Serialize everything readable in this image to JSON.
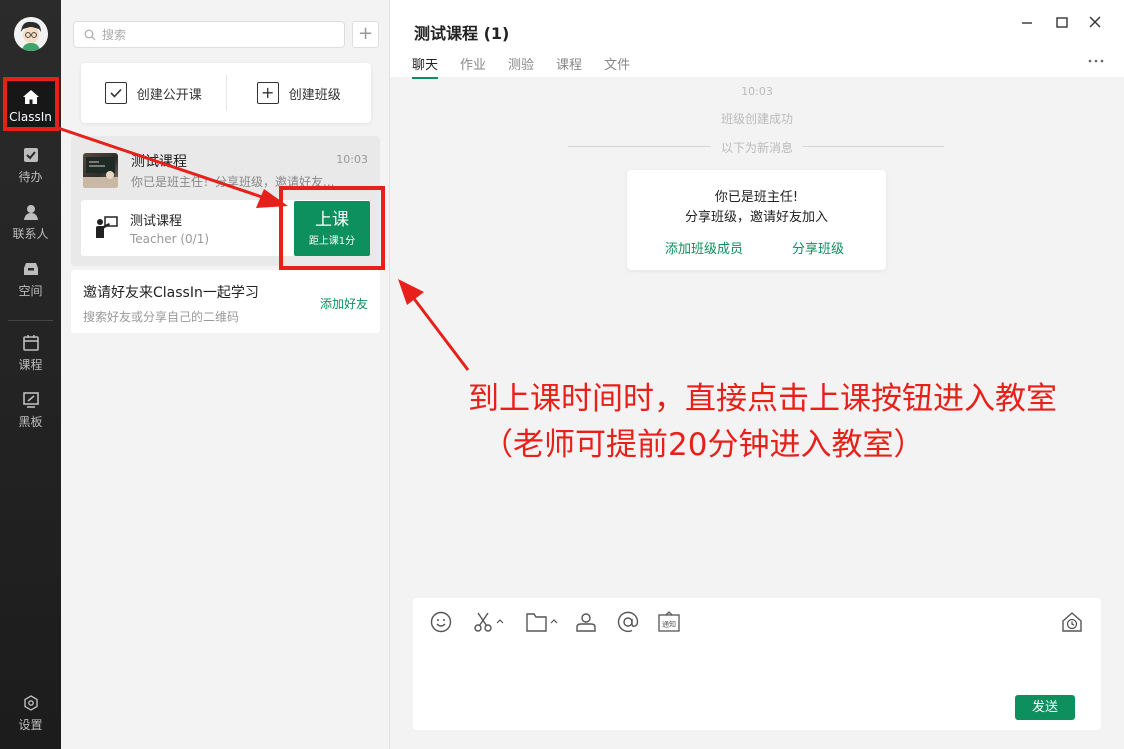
{
  "sidebar": {
    "items": [
      {
        "label": "ClassIn",
        "icon": "home-icon"
      },
      {
        "label": "待办",
        "icon": "todo-icon"
      },
      {
        "label": "联系人",
        "icon": "contacts-icon"
      },
      {
        "label": "空间",
        "icon": "space-icon"
      },
      {
        "label": "课程",
        "icon": "calendar-icon"
      },
      {
        "label": "黑板",
        "icon": "blackboard-icon"
      }
    ],
    "settings_label": "设置"
  },
  "search": {
    "placeholder": "搜索"
  },
  "create": {
    "open_course": "创建公开课",
    "create_class": "创建班级"
  },
  "course": {
    "name": "测试课程",
    "time": "10:03",
    "last_message": "你已是班主任！分享班级，邀请好友..."
  },
  "lesson": {
    "name": "测试课程",
    "role": "Teacher (0/1)",
    "start_label": "上课",
    "start_sub": "距上课1分"
  },
  "invite": {
    "title": "邀请好友来ClassIn一起学习",
    "subtitle": "搜索好友或分享自己的二维码",
    "action": "添加好友"
  },
  "chat": {
    "title": "测试课程 (1)",
    "tabs": [
      "聊天",
      "作业",
      "测验",
      "课程",
      "文件"
    ],
    "active_tab": "聊天",
    "system_time": "10:03",
    "system_message": "班级创建成功",
    "new_messages_label": "以下为新消息",
    "notice": {
      "line1": "你已是班主任!",
      "line2": "分享班级，邀请好友加入",
      "action1": "添加班级成员",
      "action2": "分享班级"
    },
    "send_label": "发送",
    "notify_label": "通知"
  },
  "annotation": {
    "line1": "到上课时间时，直接点击上课按钮进入教室",
    "line2": "（老师可提前20分钟进入教室）"
  },
  "colors": {
    "accent": "#0e8f5e",
    "annotation": "#e8201a",
    "rail": "#222222"
  }
}
